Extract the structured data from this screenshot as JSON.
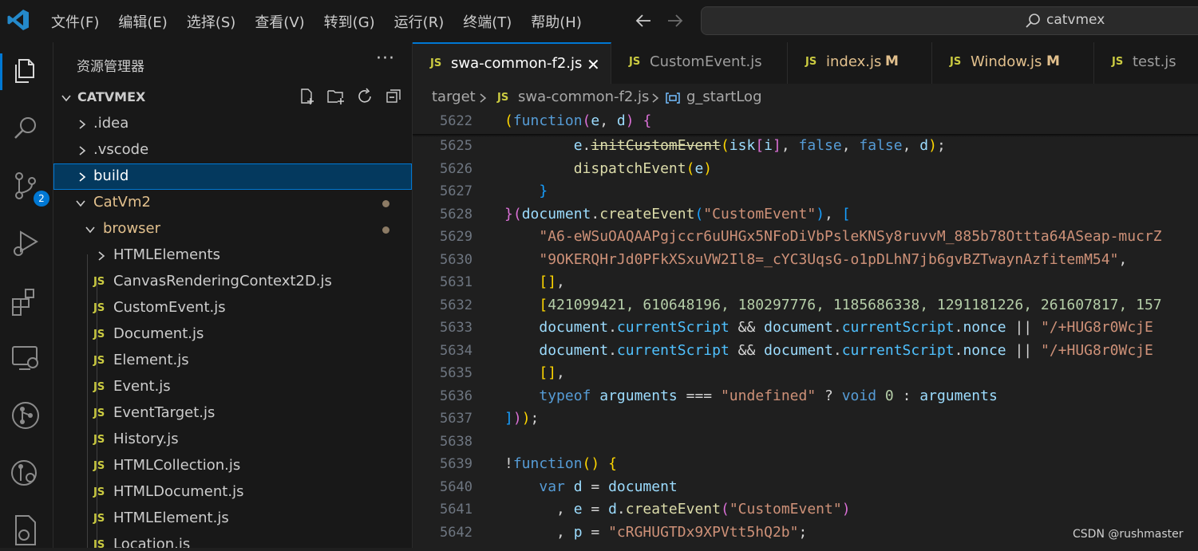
{
  "menu": [
    "文件(F)",
    "编辑(E)",
    "选择(S)",
    "查看(V)",
    "转到(G)",
    "运行(R)",
    "终端(T)",
    "帮助(H)"
  ],
  "search": {
    "text": "catvmex"
  },
  "activity": {
    "scm_badge": "2"
  },
  "sidebar": {
    "title": "资源管理器",
    "more": "···",
    "root": "CATVMEX",
    "items": [
      {
        "label": ".idea",
        "kind": "folder"
      },
      {
        "label": ".vscode",
        "kind": "folder"
      },
      {
        "label": "build",
        "kind": "folder",
        "selected": true
      },
      {
        "label": "CatVm2",
        "kind": "folder-open",
        "modified": true
      },
      {
        "label": "browser",
        "kind": "folder-open",
        "modified": true
      },
      {
        "label": "HTMLElements",
        "kind": "folder"
      },
      {
        "label": "CanvasRenderingContext2D.js",
        "kind": "js"
      },
      {
        "label": "CustomEvent.js",
        "kind": "js"
      },
      {
        "label": "Document.js",
        "kind": "js"
      },
      {
        "label": "Element.js",
        "kind": "js"
      },
      {
        "label": "Event.js",
        "kind": "js"
      },
      {
        "label": "EventTarget.js",
        "kind": "js"
      },
      {
        "label": "History.js",
        "kind": "js"
      },
      {
        "label": "HTMLCollection.js",
        "kind": "js"
      },
      {
        "label": "HTMLDocument.js",
        "kind": "js"
      },
      {
        "label": "HTMLElement.js",
        "kind": "js"
      },
      {
        "label": "Location.js",
        "kind": "js"
      }
    ]
  },
  "js_badge": "JS",
  "tabs": [
    {
      "label": "swa-common-f2.js",
      "active": true,
      "close": "✕"
    },
    {
      "label": "CustomEvent.js"
    },
    {
      "label": "index.js",
      "modified": "M"
    },
    {
      "label": "Window.js",
      "modified": "M"
    },
    {
      "label": "test.js"
    }
  ],
  "breadcrumb": {
    "folder": "target",
    "file": "swa-common-f2.js",
    "symbol": "g_startLog"
  },
  "code": {
    "line_numbers": [
      "5622",
      "5625",
      "5626",
      "5627",
      "5628",
      "5629",
      "5630",
      "5631",
      "5632",
      "5633",
      "5634",
      "5635",
      "5636",
      "5637",
      "5638",
      "5639",
      "5640",
      "5641",
      "5642"
    ],
    "strings": {
      "s1": "\"CustomEvent\"",
      "s2": "\"A6-eWSuOAQAAPgjccr6uUHGx5NFoDiVbPsleKNSy8ruvvM_885b78Ottta64ASeap-mucrZ",
      "s3": "\"9OKERQHrJd0PFkXSxuVW2Il8=_cYC3UqsG-o1pDLhN7jb6gvBZTwaynAzfitemM54\"",
      "nums": "421099421, 610648196, 180297776, 1185686338, 1291181226, 261607817, 157",
      "s4": "\"/+HUG8r0WcjE",
      "s5": "\"undefined\"",
      "s6": "\"cRGHUGTDx9XPVtt5hQ2b\""
    }
  },
  "watermark": "CSDN @rushmaster"
}
